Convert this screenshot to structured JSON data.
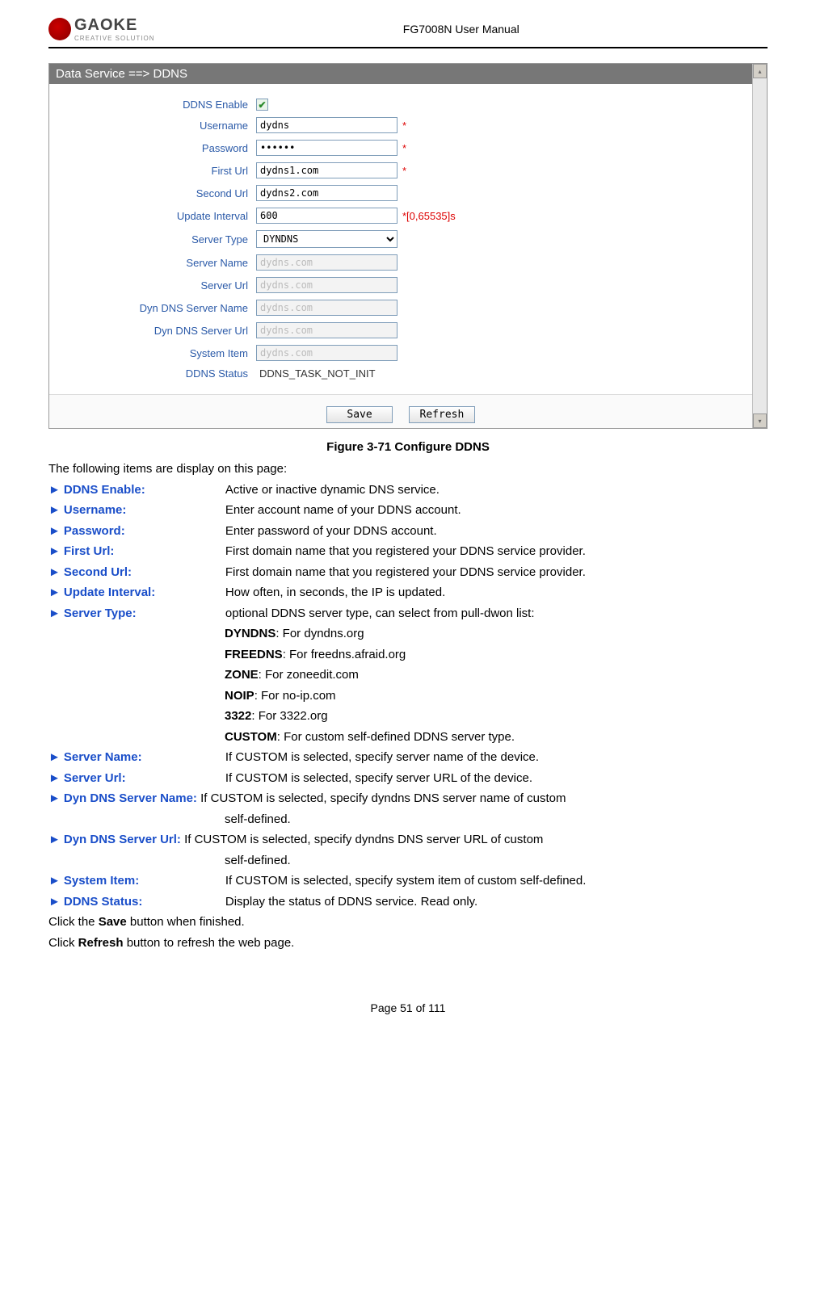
{
  "header": {
    "doc_title": "FG7008N User Manual",
    "logo_text": "GAOKE",
    "logo_sub": "CREATIVE SOLUTION"
  },
  "screenshot": {
    "titlebar": "Data Service ==> DDNS",
    "rows": {
      "ddns_enable": {
        "label": "DDNS Enable"
      },
      "username": {
        "label": "Username",
        "value": "dydns",
        "req": "*"
      },
      "password": {
        "label": "Password",
        "value": "••••••",
        "req": "*"
      },
      "first_url": {
        "label": "First Url",
        "value": "dydns1.com",
        "req": "*"
      },
      "second_url": {
        "label": "Second Url",
        "value": "dydns2.com"
      },
      "update_interval": {
        "label": "Update Interval",
        "value": "600",
        "suffix": "*[0,65535]s"
      },
      "server_type": {
        "label": "Server Type",
        "value": "DYNDNS"
      },
      "server_name": {
        "label": "Server Name",
        "value": "dydns.com"
      },
      "server_url": {
        "label": "Server Url",
        "value": "dydns.com"
      },
      "dyn_server_name": {
        "label": "Dyn DNS Server Name",
        "value": "dydns.com"
      },
      "dyn_server_url": {
        "label": "Dyn DNS Server Url",
        "value": "dydns.com"
      },
      "system_item": {
        "label": "System Item",
        "value": "dydns.com"
      },
      "ddns_status": {
        "label": "DDNS Status",
        "value": "DDNS_TASK_NOT_INIT"
      }
    },
    "buttons": {
      "save": "Save",
      "refresh": "Refresh"
    }
  },
  "figure_caption": "Figure 3-71   Configure DDNS",
  "intro": "The following items are display on this page:",
  "items": [
    {
      "term": "DDNS Enable:",
      "desc": "Active or inactive dynamic DNS service."
    },
    {
      "term": "Username:",
      "desc": "Enter account name of your DDNS account."
    },
    {
      "term": "Password:",
      "desc": "Enter password of your DDNS account."
    },
    {
      "term": "First Url:",
      "desc": "First domain name that you registered your DDNS service provider."
    },
    {
      "term": "Second Url:",
      "desc": "First domain name that you registered your DDNS service provider."
    },
    {
      "term": "Update Interval:",
      "desc": "How often, in seconds, the IP is updated."
    },
    {
      "term": "Server Type:",
      "desc": "optional DDNS server type, can select from pull-dwon list:"
    }
  ],
  "server_types": [
    {
      "name": "DYNDNS",
      "desc": ":    For dyndns.org"
    },
    {
      "name": "FREEDNS",
      "desc": ": For freedns.afraid.org"
    },
    {
      "name": "ZONE",
      "desc": ": For zoneedit.com"
    },
    {
      "name": "NOIP",
      "desc": ": For no-ip.com"
    },
    {
      "name": "3322",
      "desc": ": For 3322.org"
    },
    {
      "name": "CUSTOM",
      "desc": ": For custom self-defined DDNS server type."
    }
  ],
  "items2": [
    {
      "term": "Server Name:",
      "desc": "If CUSTOM is selected, specify server name of the device."
    },
    {
      "term": "Server Url:",
      "desc": "If CUSTOM is selected, specify server URL of the device."
    }
  ],
  "wrap1": {
    "term": "Dyn DNS Server Name:",
    "desc_a": "If CUSTOM is selected, specify dyndns DNS server name of custom",
    "desc_b": "self-defined."
  },
  "wrap2": {
    "term": "Dyn DNS Server Url:",
    "desc_a": "If CUSTOM is selected, specify dyndns DNS server URL of custom",
    "desc_b": "self-defined."
  },
  "items3": [
    {
      "term": "System Item:",
      "desc": "If CUSTOM is selected, specify system item of custom self-defined."
    },
    {
      "term": "DDNS Status:",
      "desc": "Display the status of DDNS service. Read only."
    }
  ],
  "trail1_a": "Click the ",
  "trail1_b": "Save",
  "trail1_c": " button when finished.",
  "trail2_a": "Click ",
  "trail2_b": "Refresh",
  "trail2_c": " button to refresh the web page.",
  "footer": "Page 51 of 111"
}
